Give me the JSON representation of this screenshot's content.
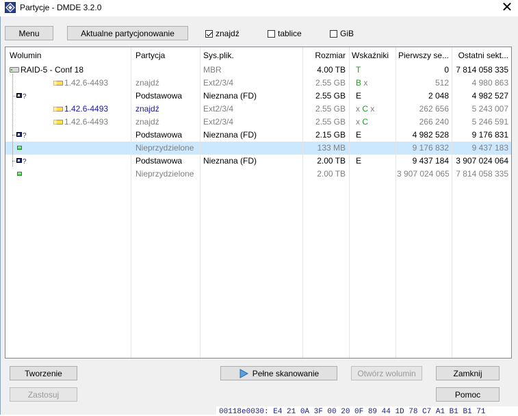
{
  "window": {
    "title": "Partycje - DMDE 3.2.0",
    "close_glyph": "✕"
  },
  "toolbar": {
    "menu_label": "Menu",
    "current_partitioning_label": "Aktualne partycjonowanie",
    "found_label": "znajdź",
    "found_checked": true,
    "tables_label": "tablice",
    "tables_checked": false,
    "gib_label": "GiB",
    "gib_checked": false
  },
  "columns": [
    "Wolumin",
    "Partycja",
    "Sys.plik.",
    "Rozmiar",
    "Wskaźniki",
    "Pierwszy se...",
    "Ostatni sekt..."
  ],
  "rows": [
    {
      "icon": "disk-icon",
      "wolumin": "RAID-5 - Conf 18",
      "wol_color": "black",
      "partycja": "",
      "part_color": "gray",
      "fs": "MBR",
      "fs_color": "gray",
      "size": "4.00 TB",
      "size_color": "black",
      "ind": [
        {
          "t": "T",
          "c": "green"
        }
      ],
      "first": "0",
      "first_color": "black",
      "last": "7 814 058 335",
      "last_color": "black"
    },
    {
      "icon": "volume-icon",
      "wolumin": "1.42.6-4493",
      "wol_color": "gray",
      "partycja": "znajdź",
      "part_color": "gray",
      "fs": "Ext2/3/4",
      "fs_color": "gray",
      "size": "2.55 GB",
      "size_color": "gray",
      "ind": [
        {
          "t": "B",
          "c": "green"
        },
        {
          "t": " x",
          "c": "gray"
        }
      ],
      "first": "512",
      "first_color": "gray",
      "last": "4 980 863",
      "last_color": "gray"
    },
    {
      "icon": "partition-icon",
      "wolumin": "",
      "wol_color": "black",
      "partycja": "Podstawowa",
      "part_color": "black",
      "fs": "Nieznana (FD)",
      "fs_color": "black",
      "size": "2.55 GB",
      "size_color": "black",
      "ind": [
        {
          "t": "E",
          "c": "black"
        }
      ],
      "first": "2 048",
      "first_color": "black",
      "last": "4 982 527",
      "last_color": "black"
    },
    {
      "icon": "volume-icon",
      "wolumin": "1.42.6-4493",
      "wol_color": "blue",
      "partycja": "znajdź",
      "part_color": "blue",
      "fs": "Ext2/3/4",
      "fs_color": "gray",
      "size": "2.55 GB",
      "size_color": "gray",
      "ind": [
        {
          "t": "x ",
          "c": "gray"
        },
        {
          "t": "C",
          "c": "green"
        },
        {
          "t": " x",
          "c": "gray"
        }
      ],
      "first": "262 656",
      "first_color": "gray",
      "last": "5 243 007",
      "last_color": "gray"
    },
    {
      "icon": "volume-icon",
      "wolumin": "1.42.6-4493",
      "wol_color": "gray",
      "partycja": "znajdź",
      "part_color": "gray",
      "fs": "Ext2/3/4",
      "fs_color": "gray",
      "size": "2.55 GB",
      "size_color": "gray",
      "ind": [
        {
          "t": "x ",
          "c": "gray"
        },
        {
          "t": "C",
          "c": "green"
        }
      ],
      "first": "266 240",
      "first_color": "gray",
      "last": "5 246 591",
      "last_color": "gray"
    },
    {
      "icon": "partition-icon",
      "wolumin": "",
      "wol_color": "black",
      "partycja": "Podstawowa",
      "part_color": "black",
      "fs": "Nieznana (FD)",
      "fs_color": "black",
      "size": "2.15 GB",
      "size_color": "black",
      "ind": [
        {
          "t": "E",
          "c": "black"
        }
      ],
      "first": "4 982 528",
      "first_color": "black",
      "last": "9 176 831",
      "last_color": "black"
    },
    {
      "icon": "free-space-icon",
      "wolumin": "",
      "wol_color": "gray",
      "partycja": "Nieprzydzielone",
      "part_color": "gray",
      "fs": "",
      "fs_color": "gray",
      "size": "133 MB",
      "size_color": "gray",
      "ind": [],
      "first": "9 176 832",
      "first_color": "gray",
      "last": "9 437 183",
      "last_color": "gray",
      "selected": true
    },
    {
      "icon": "partition-icon",
      "wolumin": "",
      "wol_color": "black",
      "partycja": "Podstawowa",
      "part_color": "black",
      "fs": "Nieznana (FD)",
      "fs_color": "black",
      "size": "2.00 TB",
      "size_color": "black",
      "ind": [
        {
          "t": "E",
          "c": "black"
        }
      ],
      "first": "9 437 184",
      "first_color": "black",
      "last": "3 907 024 064",
      "last_color": "black"
    },
    {
      "icon": "free-space-icon",
      "wolumin": "",
      "wol_color": "gray",
      "partycja": "Nieprzydzielone",
      "part_color": "gray",
      "fs": "",
      "fs_color": "gray",
      "size": "2.00 TB",
      "size_color": "gray",
      "ind": [],
      "first": "3 907 024 065",
      "first_color": "gray",
      "last": "7 814 058 335",
      "last_color": "gray"
    }
  ],
  "buttons": {
    "create_label": "Tworzenie",
    "apply_label": "Zastosuj",
    "full_scan_label": "Pełne skanowanie",
    "open_volume_label": "Otwórz wolumin",
    "close_label": "Zamknij",
    "help_label": "Pomoc"
  },
  "background_hex_text": "00118e0030: E4 21 0A 3F 00 20 0F 89  44 1D 78 C7 A1 B1 B1 71",
  "colors": {
    "selection": "#cce8ff",
    "accent_green": "#1e9e1e",
    "link_blue": "#1a1aa6"
  }
}
